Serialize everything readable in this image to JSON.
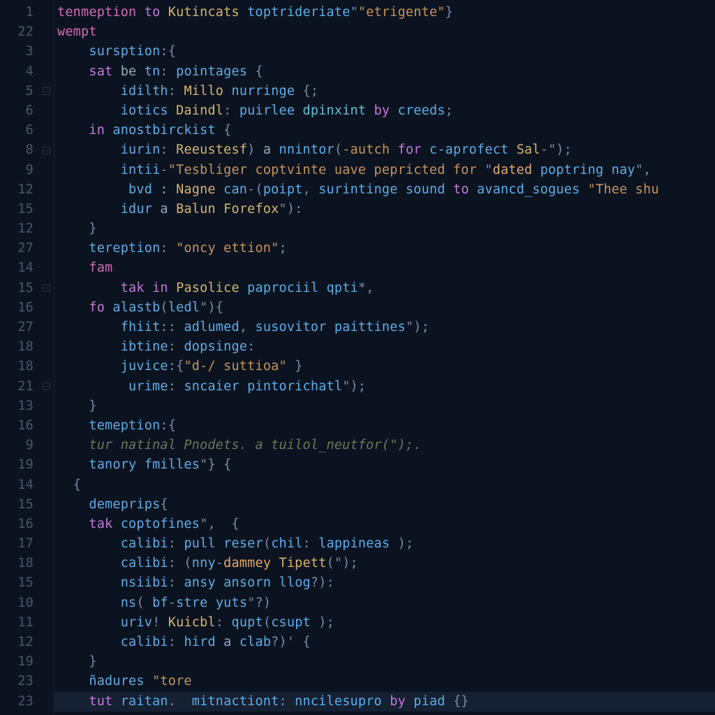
{
  "gutter": [
    "1",
    "22",
    "3",
    "4",
    "5",
    "6",
    "6",
    "8",
    "9",
    "12",
    "15",
    "12",
    "27",
    "14",
    "15",
    "16",
    "27",
    "18",
    "18",
    "21",
    "13",
    "16",
    "9",
    "19",
    "14",
    "15",
    "16",
    "17",
    "18",
    "15",
    "10",
    "11",
    "12",
    "19",
    "23",
    "23"
  ],
  "fold_marks": {
    "4": true,
    "7": true,
    "14": true,
    "19": true
  },
  "highlight_line": 35,
  "lines": [
    [
      {
        "c": "kw",
        "t": "tenmeption"
      },
      {
        "c": "id",
        "t": " "
      },
      {
        "c": "kw2",
        "t": "to"
      },
      {
        "c": "id",
        "t": " "
      },
      {
        "c": "ty",
        "t": "Kutincats"
      },
      {
        "c": "id",
        "t": " "
      },
      {
        "c": "fn",
        "t": "toptrideriate"
      },
      {
        "c": "pn",
        "t": "\""
      },
      {
        "c": "str",
        "t": "\"etrigente\""
      },
      {
        "c": "pn",
        "t": "}"
      }
    ],
    [
      {
        "c": "kw",
        "t": "wempt"
      }
    ],
    [
      {
        "c": "id",
        "t": "    "
      },
      {
        "c": "fn",
        "t": "sursption"
      },
      {
        "c": "pn",
        "t": ":{"
      }
    ],
    [
      {
        "c": "id",
        "t": "    "
      },
      {
        "c": "kw2",
        "t": "sat"
      },
      {
        "c": "id",
        "t": " be "
      },
      {
        "c": "fn",
        "t": "tn"
      },
      {
        "c": "pn",
        "t": ": "
      },
      {
        "c": "fn",
        "t": "pointages"
      },
      {
        "c": "id",
        "t": " "
      },
      {
        "c": "pn",
        "t": "{"
      }
    ],
    [
      {
        "c": "id",
        "t": "        "
      },
      {
        "c": "fn",
        "t": "idilth"
      },
      {
        "c": "pn",
        "t": ": "
      },
      {
        "c": "ty",
        "t": "Millo"
      },
      {
        "c": "id",
        "t": " "
      },
      {
        "c": "fn",
        "t": "nurringe"
      },
      {
        "c": "id",
        "t": " "
      },
      {
        "c": "pn",
        "t": "{;"
      }
    ],
    [
      {
        "c": "id",
        "t": "        "
      },
      {
        "c": "fn",
        "t": "iotics"
      },
      {
        "c": "id",
        "t": " "
      },
      {
        "c": "ty",
        "t": "Daindl"
      },
      {
        "c": "pn",
        "t": ": "
      },
      {
        "c": "fn",
        "t": "puirlee"
      },
      {
        "c": "id",
        "t": " "
      },
      {
        "c": "fn2",
        "t": "dpinxint"
      },
      {
        "c": "id",
        "t": " "
      },
      {
        "c": "kw2",
        "t": "by"
      },
      {
        "c": "id",
        "t": " "
      },
      {
        "c": "fn",
        "t": "creeds"
      },
      {
        "c": "pn",
        "t": ";"
      }
    ],
    [
      {
        "c": "id",
        "t": "    "
      },
      {
        "c": "kw2",
        "t": "in"
      },
      {
        "c": "id",
        "t": " "
      },
      {
        "c": "fn",
        "t": "anostbirckist"
      },
      {
        "c": "id",
        "t": " "
      },
      {
        "c": "pn",
        "t": "{"
      }
    ],
    [
      {
        "c": "id",
        "t": "        "
      },
      {
        "c": "fn",
        "t": "iurin"
      },
      {
        "c": "pn",
        "t": ": "
      },
      {
        "c": "ty",
        "t": "Reeustesf"
      },
      {
        "c": "pn",
        "t": ") "
      },
      {
        "c": "id",
        "t": "a "
      },
      {
        "c": "fn",
        "t": "nnintor"
      },
      {
        "c": "pn",
        "t": "("
      },
      {
        "c": "str",
        "t": "-autch"
      },
      {
        "c": "id",
        "t": " "
      },
      {
        "c": "kw2",
        "t": "for"
      },
      {
        "c": "id",
        "t": " "
      },
      {
        "c": "fn",
        "t": "c-aprofect"
      },
      {
        "c": "id",
        "t": " "
      },
      {
        "c": "ty",
        "t": "Sal"
      },
      {
        "c": "pn",
        "t": "-\");"
      }
    ],
    [
      {
        "c": "id",
        "t": "        "
      },
      {
        "c": "fn",
        "t": "intii"
      },
      {
        "c": "pn",
        "t": "-"
      },
      {
        "c": "str",
        "t": "\"Tesbliger coptvinte uave pepricted for "
      },
      {
        "c": "pn",
        "t": "\""
      },
      {
        "c": "pr",
        "t": "dated"
      },
      {
        "c": "id",
        "t": " "
      },
      {
        "c": "fn",
        "t": "poptring"
      },
      {
        "c": "id",
        "t": " "
      },
      {
        "c": "fn",
        "t": "nay"
      },
      {
        "c": "pn",
        "t": "\","
      }
    ],
    [
      {
        "c": "id",
        "t": "         "
      },
      {
        "c": "fn",
        "t": "bvd"
      },
      {
        "c": "id",
        "t": " : "
      },
      {
        "c": "ty",
        "t": "Nagne"
      },
      {
        "c": "id",
        "t": " "
      },
      {
        "c": "fn",
        "t": "can"
      },
      {
        "c": "pn",
        "t": "-("
      },
      {
        "c": "fn",
        "t": "poipt"
      },
      {
        "c": "pn",
        "t": ", "
      },
      {
        "c": "fn",
        "t": "surintinge"
      },
      {
        "c": "id",
        "t": " "
      },
      {
        "c": "fn",
        "t": "sound"
      },
      {
        "c": "id",
        "t": " "
      },
      {
        "c": "kw2",
        "t": "to"
      },
      {
        "c": "id",
        "t": " "
      },
      {
        "c": "fn",
        "t": "avancd_sogues"
      },
      {
        "c": "id",
        "t": " "
      },
      {
        "c": "str",
        "t": "\"Thee shu"
      }
    ],
    [
      {
        "c": "id",
        "t": "        "
      },
      {
        "c": "fn",
        "t": "idur"
      },
      {
        "c": "id",
        "t": " a "
      },
      {
        "c": "ty",
        "t": "Balun"
      },
      {
        "c": "id",
        "t": " "
      },
      {
        "c": "ty",
        "t": "Forefox"
      },
      {
        "c": "pn",
        "t": "\"):"
      }
    ],
    [
      {
        "c": "id",
        "t": "    "
      },
      {
        "c": "pn",
        "t": "}"
      }
    ],
    [
      {
        "c": "id",
        "t": "    "
      },
      {
        "c": "fn",
        "t": "tereption"
      },
      {
        "c": "pn",
        "t": ": "
      },
      {
        "c": "str",
        "t": "\"oncy ettion\""
      },
      {
        "c": "pn",
        "t": ";"
      }
    ],
    [
      {
        "c": "id",
        "t": "    "
      },
      {
        "c": "kw",
        "t": "fam"
      }
    ],
    [
      {
        "c": "id",
        "t": "        "
      },
      {
        "c": "kw2",
        "t": "tak"
      },
      {
        "c": "id",
        "t": " "
      },
      {
        "c": "kw2",
        "t": "in"
      },
      {
        "c": "id",
        "t": " "
      },
      {
        "c": "ty",
        "t": "Pasolice"
      },
      {
        "c": "id",
        "t": " "
      },
      {
        "c": "fn",
        "t": "paprociil"
      },
      {
        "c": "id",
        "t": " "
      },
      {
        "c": "fn",
        "t": "qpti"
      },
      {
        "c": "pn",
        "t": "*,"
      }
    ],
    [
      {
        "c": "id",
        "t": "    "
      },
      {
        "c": "kw2",
        "t": "fo"
      },
      {
        "c": "id",
        "t": " "
      },
      {
        "c": "fn",
        "t": "alastb"
      },
      {
        "c": "pn",
        "t": "("
      },
      {
        "c": "fn",
        "t": "ledl"
      },
      {
        "c": "pn",
        "t": "\"){"
      }
    ],
    [
      {
        "c": "id",
        "t": "        "
      },
      {
        "c": "fn",
        "t": "fhiit"
      },
      {
        "c": "pn",
        "t": ":: "
      },
      {
        "c": "fn",
        "t": "adlumed"
      },
      {
        "c": "pn",
        "t": ", "
      },
      {
        "c": "fn",
        "t": "susovitor"
      },
      {
        "c": "id",
        "t": " "
      },
      {
        "c": "fn",
        "t": "paittines"
      },
      {
        "c": "pn",
        "t": "\");"
      }
    ],
    [
      {
        "c": "id",
        "t": "        "
      },
      {
        "c": "fn",
        "t": "ibtine"
      },
      {
        "c": "pn",
        "t": ": "
      },
      {
        "c": "fn",
        "t": "dopsinge"
      },
      {
        "c": "pn",
        "t": ":"
      }
    ],
    [
      {
        "c": "id",
        "t": "        "
      },
      {
        "c": "fn",
        "t": "juvice"
      },
      {
        "c": "pn",
        "t": ":{"
      },
      {
        "c": "str",
        "t": "\"d-/ suttioa\""
      },
      {
        "c": "id",
        "t": " "
      },
      {
        "c": "pn",
        "t": "}"
      }
    ],
    [
      {
        "c": "id",
        "t": "         "
      },
      {
        "c": "fn",
        "t": "urime"
      },
      {
        "c": "pn",
        "t": ": "
      },
      {
        "c": "fn",
        "t": "sncaier"
      },
      {
        "c": "id",
        "t": " "
      },
      {
        "c": "fn",
        "t": "pintorichatl"
      },
      {
        "c": "pn",
        "t": "\");"
      }
    ],
    [
      {
        "c": "id",
        "t": "    "
      },
      {
        "c": "pn",
        "t": "}"
      }
    ],
    [
      {
        "c": "id",
        "t": "    "
      },
      {
        "c": "fn",
        "t": "temeption"
      },
      {
        "c": "pn",
        "t": ":{"
      }
    ],
    [
      {
        "c": "id",
        "t": "    "
      },
      {
        "c": "cm",
        "t": "tur natinal Pnodets. a tuilol_neutfor(\");."
      }
    ],
    [
      {
        "c": "id",
        "t": "    "
      },
      {
        "c": "fn",
        "t": "tanory"
      },
      {
        "c": "id",
        "t": " "
      },
      {
        "c": "fn",
        "t": "fmilles"
      },
      {
        "c": "pn",
        "t": "\"} {"
      }
    ],
    [
      {
        "c": "id",
        "t": "  "
      },
      {
        "c": "pn",
        "t": "{"
      }
    ],
    [
      {
        "c": "id",
        "t": "    "
      },
      {
        "c": "fn",
        "t": "demeprips"
      },
      {
        "c": "pn",
        "t": "{"
      }
    ],
    [
      {
        "c": "id",
        "t": "    "
      },
      {
        "c": "kw2",
        "t": "tak"
      },
      {
        "c": "id",
        "t": " "
      },
      {
        "c": "fn",
        "t": "coptofines"
      },
      {
        "c": "pn",
        "t": "\",  {"
      }
    ],
    [
      {
        "c": "id",
        "t": "        "
      },
      {
        "c": "fn",
        "t": "calibi"
      },
      {
        "c": "pn",
        "t": ": "
      },
      {
        "c": "fn",
        "t": "pull"
      },
      {
        "c": "id",
        "t": " "
      },
      {
        "c": "fn",
        "t": "reser"
      },
      {
        "c": "pn",
        "t": "("
      },
      {
        "c": "fn",
        "t": "chil"
      },
      {
        "c": "pn",
        "t": ": "
      },
      {
        "c": "fn",
        "t": "lappineas"
      },
      {
        "c": "id",
        "t": " "
      },
      {
        "c": "pn",
        "t": ");"
      }
    ],
    [
      {
        "c": "id",
        "t": "        "
      },
      {
        "c": "fn",
        "t": "calibi"
      },
      {
        "c": "pn",
        "t": ": ("
      },
      {
        "c": "fn",
        "t": "nny"
      },
      {
        "c": "pn",
        "t": "-"
      },
      {
        "c": "pr",
        "t": "dammey"
      },
      {
        "c": "id",
        "t": " "
      },
      {
        "c": "ty",
        "t": "Tipett"
      },
      {
        "c": "pn",
        "t": "(\");"
      }
    ],
    [
      {
        "c": "id",
        "t": "        "
      },
      {
        "c": "fn",
        "t": "nsiibi"
      },
      {
        "c": "pn",
        "t": ": "
      },
      {
        "c": "fn",
        "t": "ansy"
      },
      {
        "c": "id",
        "t": " "
      },
      {
        "c": "fn",
        "t": "ansorn"
      },
      {
        "c": "id",
        "t": " "
      },
      {
        "c": "fn",
        "t": "llog"
      },
      {
        "c": "pn",
        "t": "?):"
      }
    ],
    [
      {
        "c": "id",
        "t": "        "
      },
      {
        "c": "fn",
        "t": "ns"
      },
      {
        "c": "pn",
        "t": "( "
      },
      {
        "c": "fn",
        "t": "bf"
      },
      {
        "c": "pn",
        "t": "-"
      },
      {
        "c": "fn",
        "t": "stre"
      },
      {
        "c": "id",
        "t": " "
      },
      {
        "c": "fn",
        "t": "yuts"
      },
      {
        "c": "pn",
        "t": "\"?)"
      }
    ],
    [
      {
        "c": "id",
        "t": "        "
      },
      {
        "c": "fn",
        "t": "uriv"
      },
      {
        "c": "pn",
        "t": "! "
      },
      {
        "c": "ty",
        "t": "Kuicbl"
      },
      {
        "c": "pn",
        "t": ": "
      },
      {
        "c": "fn",
        "t": "qupt"
      },
      {
        "c": "pn",
        "t": "("
      },
      {
        "c": "fn",
        "t": "csupt"
      },
      {
        "c": "id",
        "t": " "
      },
      {
        "c": "pn",
        "t": ");"
      }
    ],
    [
      {
        "c": "id",
        "t": "        "
      },
      {
        "c": "fn",
        "t": "calibi"
      },
      {
        "c": "pn",
        "t": ": "
      },
      {
        "c": "fn",
        "t": "hird"
      },
      {
        "c": "id",
        "t": " a "
      },
      {
        "c": "fn",
        "t": "clab"
      },
      {
        "c": "pn",
        "t": "?)' {"
      }
    ],
    [
      {
        "c": "id",
        "t": "    "
      },
      {
        "c": "pn",
        "t": "}"
      }
    ],
    [
      {
        "c": "id",
        "t": "    "
      },
      {
        "c": "fn",
        "t": "ñadures"
      },
      {
        "c": "id",
        "t": " "
      },
      {
        "c": "str",
        "t": "\"tore"
      }
    ],
    [
      {
        "c": "id",
        "t": "    "
      },
      {
        "c": "kw2",
        "t": "tut"
      },
      {
        "c": "id",
        "t": " "
      },
      {
        "c": "fn",
        "t": "raitan"
      },
      {
        "c": "pn",
        "t": ".  "
      },
      {
        "c": "fn",
        "t": "mitnactiont"
      },
      {
        "c": "pn",
        "t": ": "
      },
      {
        "c": "fn",
        "t": "nncilesupro"
      },
      {
        "c": "id",
        "t": " "
      },
      {
        "c": "kw2",
        "t": "by"
      },
      {
        "c": "id",
        "t": " "
      },
      {
        "c": "fn",
        "t": "piad"
      },
      {
        "c": "id",
        "t": " "
      },
      {
        "c": "pn",
        "t": "{}"
      }
    ]
  ]
}
